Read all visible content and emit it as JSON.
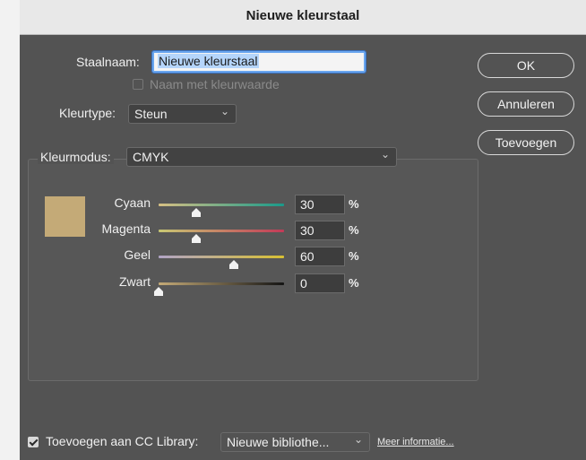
{
  "window": {
    "title": "Nieuwe kleurstaal"
  },
  "form": {
    "name_label": "Staalnaam:",
    "name_value": "Nieuwe kleurstaal",
    "name_with_value_label": "Naam met kleurwaarde",
    "type_label": "Kleurtype:",
    "type_value": "Steun",
    "mode_label": "Kleurmodus:",
    "mode_value": "CMYK"
  },
  "buttons": {
    "ok": "OK",
    "cancel": "Annuleren",
    "add": "Toevoegen"
  },
  "sliders": [
    {
      "label": "Cyaan",
      "value": "30",
      "unit": "%",
      "level": 30,
      "gradient": [
        "#d6bf83",
        "#1a9a8a"
      ]
    },
    {
      "label": "Magenta",
      "value": "30",
      "unit": "%",
      "level": 30,
      "gradient": [
        "#c8c873",
        "#c33a58"
      ]
    },
    {
      "label": "Geel",
      "value": "60",
      "unit": "%",
      "level": 60,
      "gradient": [
        "#b1a4c6",
        "#d8c033"
      ]
    },
    {
      "label": "Zwart",
      "value": "0",
      "unit": "%",
      "level": 0,
      "gradient": [
        "#c4aa77",
        "#141414"
      ]
    }
  ],
  "swatch_color": "#c4aa77",
  "footer": {
    "cc_label": "Toevoegen aan CC Library:",
    "cc_checked": true,
    "library_value": "Nieuwe bibliothe...",
    "more_info": "Meer informatie..."
  },
  "icons": {
    "chevron": "chevron-down-icon",
    "checkmark": "checkmark-icon"
  }
}
